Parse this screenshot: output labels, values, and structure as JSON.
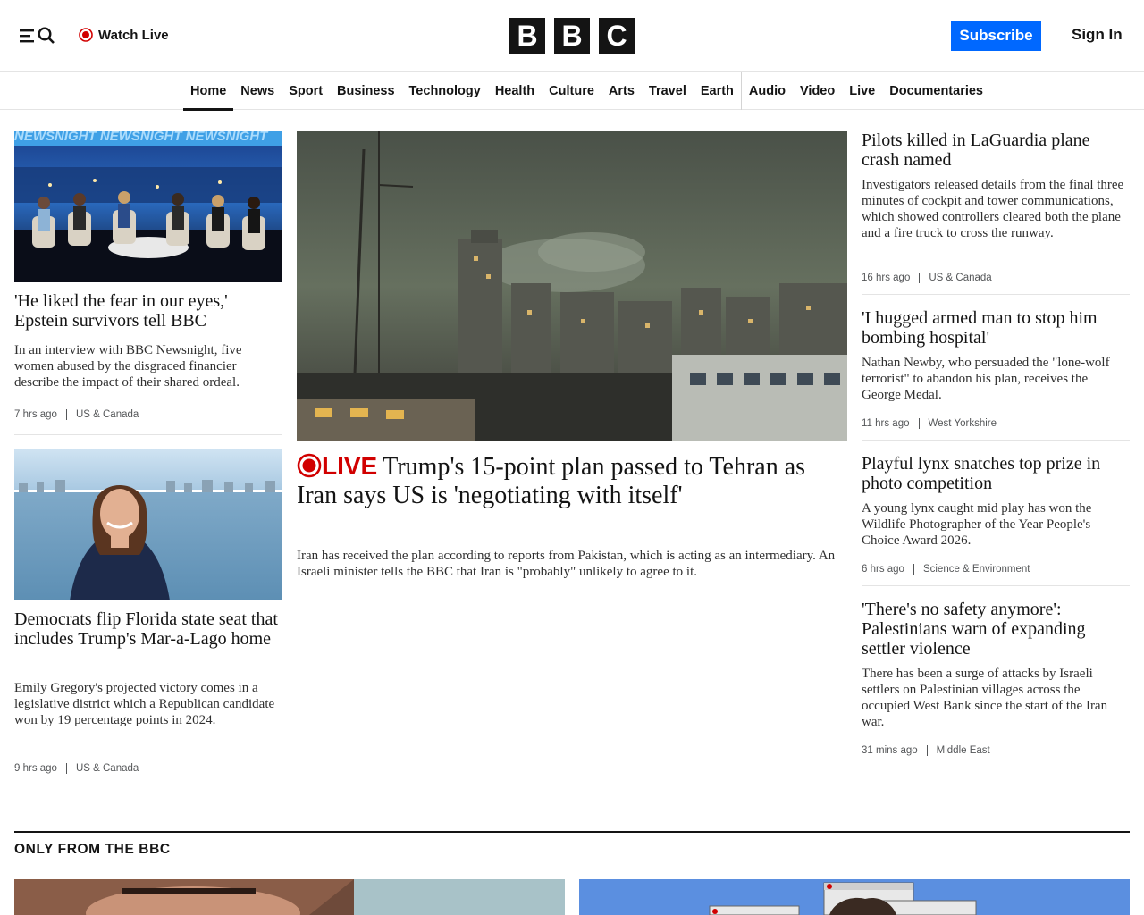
{
  "header": {
    "watch_live": "Watch Live",
    "logo_letters": [
      "B",
      "B",
      "C"
    ],
    "subscribe": "Subscribe",
    "sign_in": "Sign In"
  },
  "nav": {
    "items": [
      "Home",
      "News",
      "Sport",
      "Business",
      "Technology",
      "Health",
      "Culture",
      "Arts",
      "Travel",
      "Earth",
      "Audio",
      "Video",
      "Live",
      "Documentaries"
    ]
  },
  "left": {
    "story1": {
      "image_text": "NEWSNIGHT NEWSNIGHT NEWSNIGHT",
      "headline": "'He liked the fear in our eyes,' Epstein survivors tell BBC",
      "summary": "In an interview with BBC Newsnight, five women abused by the disgraced financier describe the impact of their shared ordeal.",
      "time": "7 hrs ago",
      "category": "US & Canada"
    },
    "story2": {
      "headline": "Democrats flip Florida state seat that includes Trump's Mar-a-Lago home",
      "summary": "Emily Gregory's projected victory comes in a legislative district which a Republican candidate won by 19 percentage points in 2024.",
      "time": "9 hrs ago",
      "category": "US & Canada"
    }
  },
  "center": {
    "live_label": "LIVE",
    "headline": "Trump's 15-point plan passed to Tehran as Iran says US is 'negotiating with itself'",
    "summary": "Iran has received the plan according to reports from Pakistan, which is acting as an intermediary. An Israeli minister tells the BBC that Iran is \"probably\" unlikely to agree to it."
  },
  "right": {
    "stories": [
      {
        "headline": "Pilots killed in LaGuardia plane crash named",
        "summary": "Investigators released details from the final three minutes of cockpit and tower communications, which showed controllers cleared both the plane and a fire truck to cross the runway.",
        "time": "16 hrs ago",
        "category": "US & Canada"
      },
      {
        "headline": "'I hugged armed man to stop him bombing hospital'",
        "summary": "Nathan Newby, who persuaded the \"lone-wolf terrorist\" to abandon his plan, receives the George Medal.",
        "time": "11 hrs ago",
        "category": "West Yorkshire"
      },
      {
        "headline": "Playful lynx snatches top prize in photo competition",
        "summary": "A young lynx caught mid play has won the Wildlife Photographer of the Year People's Choice Award 2026.",
        "time": "6 hrs ago",
        "category": "Science & Environment"
      },
      {
        "headline": "'There's no safety anymore': Palestinians warn of expanding settler violence",
        "summary": "There has been a surge of attacks by Israeli settlers on Palestinian villages across the occupied West Bank since the start of the Iran war.",
        "time": "31 mins ago",
        "category": "Middle East"
      }
    ]
  },
  "section": {
    "title": "ONLY FROM THE BBC"
  },
  "colors": {
    "brand_blue": "#0068ff",
    "live_red": "#d10000",
    "text": "#141414"
  }
}
